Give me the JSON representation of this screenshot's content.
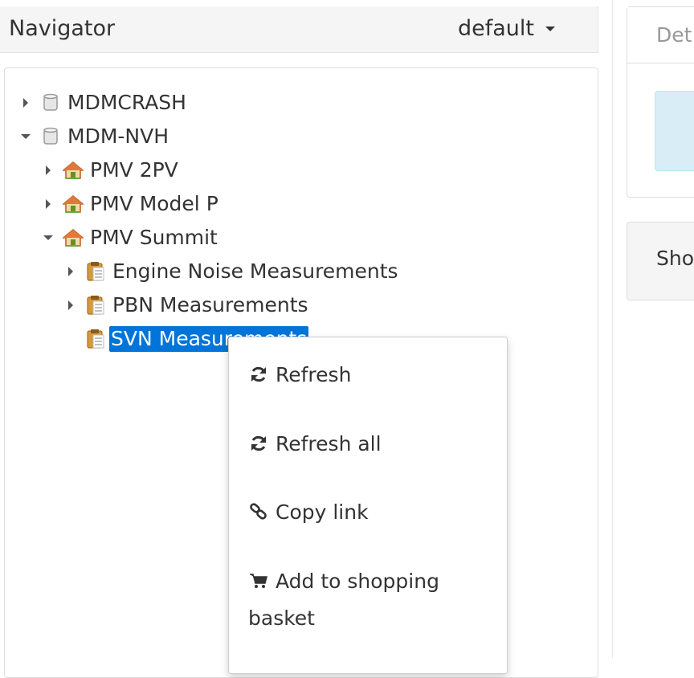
{
  "navigator": {
    "title": "Navigator",
    "source_selector": "default"
  },
  "tree": {
    "nodes": [
      {
        "label": "MDMCRASH",
        "type": "datasource",
        "expanded": false,
        "selected": false
      },
      {
        "label": "MDM-NVH",
        "type": "datasource",
        "expanded": true,
        "selected": false
      },
      {
        "label": "PMV 2PV",
        "type": "project",
        "expanded": false,
        "selected": false
      },
      {
        "label": "PMV Model P",
        "type": "project",
        "expanded": false,
        "selected": false
      },
      {
        "label": "PMV Summit",
        "type": "project",
        "expanded": true,
        "selected": false
      },
      {
        "label": "Engine Noise Measurements",
        "type": "pool",
        "expanded": false,
        "selected": false
      },
      {
        "label": "PBN Measurements",
        "type": "pool",
        "expanded": false,
        "selected": false
      },
      {
        "label": "SVN Measurements",
        "type": "pool",
        "expanded": false,
        "selected": true
      }
    ]
  },
  "right_panel": {
    "details_title": "Det",
    "shopping_title": "Sho"
  },
  "context_menu": {
    "items": [
      {
        "label": "Refresh",
        "icon": "refresh-icon"
      },
      {
        "label": "Refresh all",
        "icon": "refresh-icon"
      },
      {
        "label": "Copy link",
        "icon": "link-icon"
      },
      {
        "label": "Add to shopping basket",
        "icon": "shopping-cart-icon"
      }
    ]
  },
  "colors": {
    "selection": "#0074d9",
    "header_bg": "#f5f5f5",
    "project_icon": "#c8602a",
    "pool_icon": "#d69a3a"
  }
}
